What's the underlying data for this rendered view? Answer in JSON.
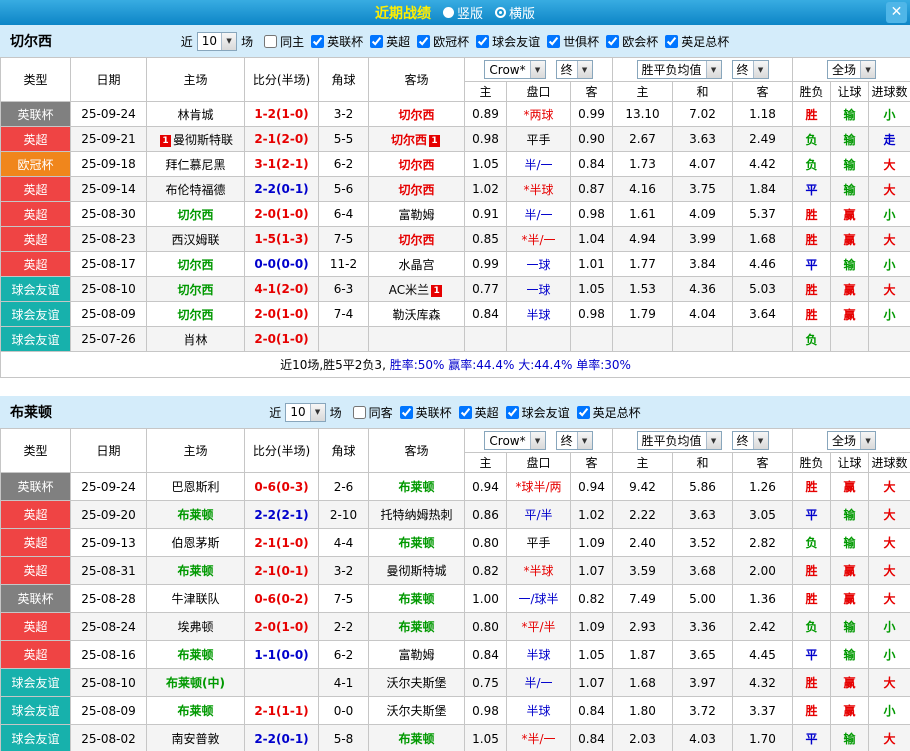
{
  "titlebar": {
    "title": "近期战绩",
    "vertical_label": "竖版",
    "horizontal_label": "横版",
    "selected_layout": "横版",
    "close_label": "✕"
  },
  "palette": {
    "red": "#e60000",
    "green": "#009900",
    "blue": "#0000cc",
    "black": "#000000"
  },
  "type_colors": {
    "英联杯": "#808080",
    "英超": "#ef4444",
    "欧冠杯": "#f0861c",
    "球会友谊": "#17b1ac"
  },
  "table_header": {
    "static_cols": [
      "类型",
      "日期",
      "主场",
      "比分(半场)",
      "角球",
      "客场"
    ],
    "odds_company": "Crow*",
    "final_label": "终",
    "avg_label": "胜平负均值",
    "scope_label": "全场",
    "sub_cols": [
      "主",
      "盘口",
      "客",
      "主",
      "和",
      "客",
      "胜负",
      "让球",
      "进球数"
    ]
  },
  "sections": [
    {
      "team": "切尔西",
      "filter": {
        "near_label": "近",
        "count": "10",
        "unit_label": "场",
        "options": [
          {
            "label": "同主",
            "checked": false
          },
          {
            "label": "英联杯",
            "checked": true
          },
          {
            "label": "英超",
            "checked": true
          },
          {
            "label": "欧冠杯",
            "checked": true
          },
          {
            "label": "球会友谊",
            "checked": true
          },
          {
            "label": "世俱杯",
            "checked": true
          },
          {
            "label": "欧会杯",
            "checked": true
          },
          {
            "label": "英足总杯",
            "checked": true
          }
        ]
      },
      "rows": [
        {
          "type": "英联杯",
          "date": "25-09-24",
          "home": "林肯城",
          "home_color": "black",
          "score": "1-2(1-0)",
          "score_color": "red",
          "corner": "3-2",
          "away": "切尔西",
          "away_color": "red",
          "odds": [
            "0.89",
            "*两球",
            "0.99"
          ],
          "handicap_color": "red",
          "avg": [
            "13.10",
            "7.02",
            "1.18"
          ],
          "res": [
            [
              "胜",
              "red"
            ],
            [
              "输",
              "green"
            ],
            [
              "小",
              "green"
            ]
          ]
        },
        {
          "type": "英超",
          "date": "25-09-21",
          "home": "曼彻斯特联",
          "home_color": "black",
          "home_rc": "1",
          "score": "2-1(2-0)",
          "score_color": "red",
          "corner": "5-5",
          "away": "切尔西",
          "away_color": "red",
          "away_rc": "1",
          "odds": [
            "0.98",
            "平手",
            "0.90"
          ],
          "handicap_color": "black",
          "avg": [
            "2.67",
            "3.63",
            "2.49"
          ],
          "res": [
            [
              "负",
              "green"
            ],
            [
              "输",
              "green"
            ],
            [
              "走",
              "blue"
            ]
          ]
        },
        {
          "type": "欧冠杯",
          "date": "25-09-18",
          "home": "拜仁慕尼黑",
          "home_color": "black",
          "score": "3-1(2-1)",
          "score_color": "red",
          "corner": "6-2",
          "away": "切尔西",
          "away_color": "red",
          "odds": [
            "1.05",
            "半/一",
            "0.84"
          ],
          "handicap_color": "blue",
          "avg": [
            "1.73",
            "4.07",
            "4.42"
          ],
          "res": [
            [
              "负",
              "green"
            ],
            [
              "输",
              "green"
            ],
            [
              "大",
              "red"
            ]
          ]
        },
        {
          "type": "英超",
          "date": "25-09-14",
          "home": "布伦特福德",
          "home_color": "black",
          "score": "2-2(0-1)",
          "score_color": "blue",
          "corner": "5-6",
          "away": "切尔西",
          "away_color": "red",
          "odds": [
            "1.02",
            "*半球",
            "0.87"
          ],
          "handicap_color": "red",
          "avg": [
            "4.16",
            "3.75",
            "1.84"
          ],
          "res": [
            [
              "平",
              "blue"
            ],
            [
              "输",
              "green"
            ],
            [
              "大",
              "red"
            ]
          ]
        },
        {
          "type": "英超",
          "date": "25-08-30",
          "home": "切尔西",
          "home_color": "green",
          "score": "2-0(1-0)",
          "score_color": "red",
          "corner": "6-4",
          "away": "富勒姆",
          "away_color": "black",
          "odds": [
            "0.91",
            "半/一",
            "0.98"
          ],
          "handicap_color": "blue",
          "avg": [
            "1.61",
            "4.09",
            "5.37"
          ],
          "res": [
            [
              "胜",
              "red"
            ],
            [
              "赢",
              "red"
            ],
            [
              "小",
              "green"
            ]
          ]
        },
        {
          "type": "英超",
          "date": "25-08-23",
          "home": "西汉姆联",
          "home_color": "black",
          "score": "1-5(1-3)",
          "score_color": "red",
          "corner": "7-5",
          "away": "切尔西",
          "away_color": "red",
          "odds": [
            "0.85",
            "*半/一",
            "1.04"
          ],
          "handicap_color": "red",
          "avg": [
            "4.94",
            "3.99",
            "1.68"
          ],
          "res": [
            [
              "胜",
              "red"
            ],
            [
              "赢",
              "red"
            ],
            [
              "大",
              "red"
            ]
          ]
        },
        {
          "type": "英超",
          "date": "25-08-17",
          "home": "切尔西",
          "home_color": "green",
          "score": "0-0(0-0)",
          "score_color": "blue",
          "corner": "11-2",
          "away": "水晶宫",
          "away_color": "black",
          "odds": [
            "0.99",
            "一球",
            "1.01"
          ],
          "handicap_color": "blue",
          "avg": [
            "1.77",
            "3.84",
            "4.46"
          ],
          "res": [
            [
              "平",
              "blue"
            ],
            [
              "输",
              "green"
            ],
            [
              "小",
              "green"
            ]
          ]
        },
        {
          "type": "球会友谊",
          "date": "25-08-10",
          "home": "切尔西",
          "home_color": "green",
          "score": "4-1(2-0)",
          "score_color": "red",
          "corner": "6-3",
          "away": "AC米兰",
          "away_color": "black",
          "away_rc": "1",
          "odds": [
            "0.77",
            "一球",
            "1.05"
          ],
          "handicap_color": "blue",
          "avg": [
            "1.53",
            "4.36",
            "5.03"
          ],
          "res": [
            [
              "胜",
              "red"
            ],
            [
              "赢",
              "red"
            ],
            [
              "大",
              "red"
            ]
          ]
        },
        {
          "type": "球会友谊",
          "date": "25-08-09",
          "home": "切尔西",
          "home_color": "green",
          "score": "2-0(1-0)",
          "score_color": "red",
          "corner": "7-4",
          "away": "勒沃库森",
          "away_color": "black",
          "odds": [
            "0.84",
            "半球",
            "0.98"
          ],
          "handicap_color": "blue",
          "avg": [
            "1.79",
            "4.04",
            "3.64"
          ],
          "res": [
            [
              "胜",
              "red"
            ],
            [
              "赢",
              "red"
            ],
            [
              "小",
              "green"
            ]
          ]
        },
        {
          "type": "球会友谊",
          "date": "25-07-26",
          "home": "肖林",
          "home_color": "black",
          "score": "2-0(1-0)",
          "score_color": "red",
          "corner": "",
          "away": "",
          "away_color": "black",
          "odds": [
            "",
            "",
            ""
          ],
          "handicap_color": "black",
          "avg": [
            "",
            "",
            ""
          ],
          "res": [
            [
              "负",
              "green"
            ],
            [
              "",
              ""
            ],
            [
              "",
              ""
            ]
          ]
        }
      ],
      "summary": {
        "segments": [
          {
            "text": "近10场,胜5平2负3, ",
            "color": "#000000"
          },
          {
            "text": "胜率:50% ",
            "color": "#0000cc"
          },
          {
            "text": "赢率:44.4% ",
            "color": "#0000cc"
          },
          {
            "text": "大:44.4% ",
            "color": "#0000cc"
          },
          {
            "text": "单率:30%",
            "color": "#0000cc"
          }
        ]
      }
    },
    {
      "team": "布莱顿",
      "filter": {
        "near_label": "近",
        "count": "10",
        "unit_label": "场",
        "options": [
          {
            "label": "同客",
            "checked": false
          },
          {
            "label": "英联杯",
            "checked": true
          },
          {
            "label": "英超",
            "checked": true
          },
          {
            "label": "球会友谊",
            "checked": true
          },
          {
            "label": "英足总杯",
            "checked": true
          }
        ]
      },
      "rows": [
        {
          "type": "英联杯",
          "date": "25-09-24",
          "home": "巴恩斯利",
          "home_color": "black",
          "score": "0-6(0-3)",
          "score_color": "red",
          "corner": "2-6",
          "away": "布莱顿",
          "away_color": "green",
          "odds": [
            "0.94",
            "*球半/两",
            "0.94"
          ],
          "handicap_color": "red",
          "avg": [
            "9.42",
            "5.86",
            "1.26"
          ],
          "res": [
            [
              "胜",
              "red"
            ],
            [
              "赢",
              "red"
            ],
            [
              "大",
              "red"
            ]
          ]
        },
        {
          "type": "英超",
          "date": "25-09-20",
          "home": "布莱顿",
          "home_color": "green",
          "score": "2-2(2-1)",
          "score_color": "blue",
          "corner": "2-10",
          "away": "托特纳姆热刺",
          "away_color": "black",
          "odds": [
            "0.86",
            "平/半",
            "1.02"
          ],
          "handicap_color": "blue",
          "avg": [
            "2.22",
            "3.63",
            "3.05"
          ],
          "res": [
            [
              "平",
              "blue"
            ],
            [
              "输",
              "green"
            ],
            [
              "大",
              "red"
            ]
          ]
        },
        {
          "type": "英超",
          "date": "25-09-13",
          "home": "伯恩茅斯",
          "home_color": "black",
          "score": "2-1(1-0)",
          "score_color": "red",
          "corner": "4-4",
          "away": "布莱顿",
          "away_color": "green",
          "odds": [
            "0.80",
            "平手",
            "1.09"
          ],
          "handicap_color": "black",
          "avg": [
            "2.40",
            "3.52",
            "2.82"
          ],
          "res": [
            [
              "负",
              "green"
            ],
            [
              "输",
              "green"
            ],
            [
              "大",
              "red"
            ]
          ]
        },
        {
          "type": "英超",
          "date": "25-08-31",
          "home": "布莱顿",
          "home_color": "green",
          "score": "2-1(0-1)",
          "score_color": "red",
          "corner": "3-2",
          "away": "曼彻斯特城",
          "away_color": "black",
          "odds": [
            "0.82",
            "*半球",
            "1.07"
          ],
          "handicap_color": "red",
          "avg": [
            "3.59",
            "3.68",
            "2.00"
          ],
          "res": [
            [
              "胜",
              "red"
            ],
            [
              "赢",
              "red"
            ],
            [
              "大",
              "red"
            ]
          ]
        },
        {
          "type": "英联杯",
          "date": "25-08-28",
          "home": "牛津联队",
          "home_color": "black",
          "score": "0-6(0-2)",
          "score_color": "red",
          "corner": "7-5",
          "away": "布莱顿",
          "away_color": "green",
          "odds": [
            "1.00",
            "一/球半",
            "0.82"
          ],
          "handicap_color": "blue",
          "avg": [
            "7.49",
            "5.00",
            "1.36"
          ],
          "res": [
            [
              "胜",
              "red"
            ],
            [
              "赢",
              "red"
            ],
            [
              "大",
              "red"
            ]
          ]
        },
        {
          "type": "英超",
          "date": "25-08-24",
          "home": "埃弗顿",
          "home_color": "black",
          "score": "2-0(1-0)",
          "score_color": "red",
          "corner": "2-2",
          "away": "布莱顿",
          "away_color": "green",
          "odds": [
            "0.80",
            "*平/半",
            "1.09"
          ],
          "handicap_color": "red",
          "avg": [
            "2.93",
            "3.36",
            "2.42"
          ],
          "res": [
            [
              "负",
              "green"
            ],
            [
              "输",
              "green"
            ],
            [
              "小",
              "green"
            ]
          ]
        },
        {
          "type": "英超",
          "date": "25-08-16",
          "home": "布莱顿",
          "home_color": "green",
          "score": "1-1(0-0)",
          "score_color": "blue",
          "corner": "6-2",
          "away": "富勒姆",
          "away_color": "black",
          "odds": [
            "0.84",
            "半球",
            "1.05"
          ],
          "handicap_color": "blue",
          "avg": [
            "1.87",
            "3.65",
            "4.45"
          ],
          "res": [
            [
              "平",
              "blue"
            ],
            [
              "输",
              "green"
            ],
            [
              "小",
              "green"
            ]
          ]
        },
        {
          "type": "球会友谊",
          "date": "25-08-10",
          "home": "布莱顿(中)",
          "home_color": "green",
          "score": "",
          "score_color": "red",
          "corner": "4-1",
          "away": "沃尔夫斯堡",
          "away_color": "black",
          "odds": [
            "0.75",
            "半/一",
            "1.07"
          ],
          "handicap_color": "blue",
          "avg": [
            "1.68",
            "3.97",
            "4.32"
          ],
          "res": [
            [
              "胜",
              "red"
            ],
            [
              "赢",
              "red"
            ],
            [
              "大",
              "red"
            ]
          ]
        },
        {
          "type": "球会友谊",
          "date": "25-08-09",
          "home": "布莱顿",
          "home_color": "green",
          "score": "2-1(1-1)",
          "score_color": "red",
          "corner": "0-0",
          "away": "沃尔夫斯堡",
          "away_color": "black",
          "odds": [
            "0.98",
            "半球",
            "0.84"
          ],
          "handicap_color": "blue",
          "avg": [
            "1.80",
            "3.72",
            "3.37"
          ],
          "res": [
            [
              "胜",
              "red"
            ],
            [
              "赢",
              "red"
            ],
            [
              "小",
              "green"
            ]
          ]
        },
        {
          "type": "球会友谊",
          "date": "25-08-02",
          "home": "南安普敦",
          "home_color": "black",
          "score": "2-2(0-1)",
          "score_color": "blue",
          "corner": "5-8",
          "away": "布莱顿",
          "away_color": "green",
          "odds": [
            "1.05",
            "*半/一",
            "0.84"
          ],
          "handicap_color": "red",
          "avg": [
            "2.03",
            "4.03",
            "1.70"
          ],
          "res": [
            [
              "平",
              "blue"
            ],
            [
              "输",
              "green"
            ],
            [
              "大",
              "red"
            ]
          ]
        }
      ]
    }
  ]
}
